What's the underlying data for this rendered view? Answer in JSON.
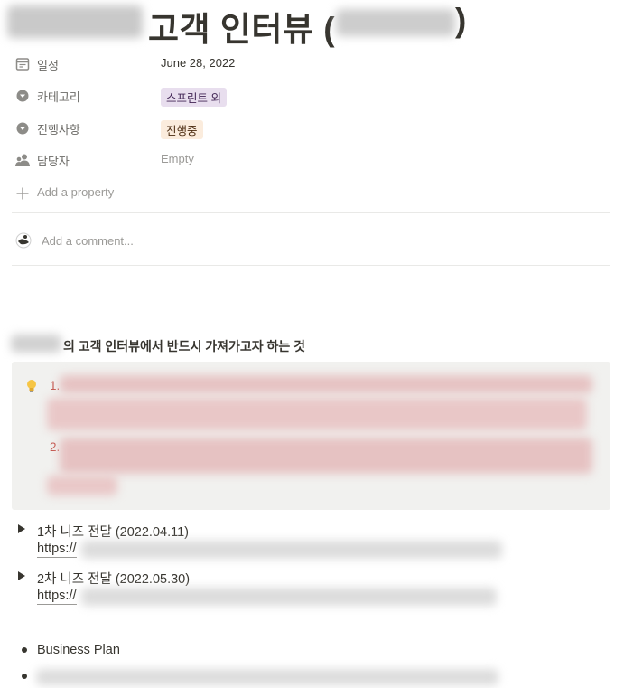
{
  "page": {
    "title": "고객 인터뷰 (",
    "title_close": ")"
  },
  "properties": [
    {
      "icon": "calendar-icon",
      "name": "일정",
      "value": "June 28, 2022"
    },
    {
      "icon": "select-icon",
      "name": "카테고리",
      "value": "스프린트 외",
      "tag_color": "#e8deee",
      "tag_text_color": "#412454"
    },
    {
      "icon": "select-icon",
      "name": "진행사항",
      "value": "진행중",
      "tag_color": "#fbecdd",
      "tag_text_color": "#49290e"
    },
    {
      "icon": "person-icon",
      "name": "담당자",
      "value": "Empty"
    }
  ],
  "add_property_label": "Add a property",
  "comment_placeholder": "Add a comment...",
  "heading": "의 고객 인터뷰에서 반드시 가져가고자 하는 것",
  "callout": {
    "items": [
      "1.",
      "2."
    ]
  },
  "toggles": [
    {
      "label": "1차 니즈 전달 (2022.04.11)",
      "link_prefix": "https://"
    },
    {
      "label": "2차 니즈 전달 (2022.05.30)",
      "link_prefix": "https://"
    }
  ],
  "bullets": [
    {
      "text": "Business Plan"
    }
  ]
}
